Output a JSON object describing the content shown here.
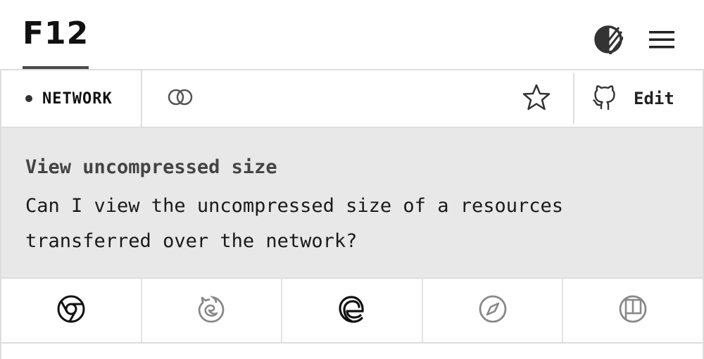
{
  "header": {
    "logo_text": "F12",
    "theme_icon": "contrast-icon",
    "menu_icon": "hamburger-menu-icon"
  },
  "toolbar": {
    "category_label": "NETWORK",
    "link_icon": "link-icon",
    "star_icon": "star-icon",
    "edit_icon": "github-icon",
    "edit_label": "Edit"
  },
  "question": {
    "title": "View uncompressed size",
    "text": "Can I view the uncompressed size of a resources transferred over the network?"
  },
  "browsers": [
    {
      "name": "chrome",
      "icon": "chrome-icon",
      "color": "#111111"
    },
    {
      "name": "firefox",
      "icon": "firefox-icon",
      "color": "#888888"
    },
    {
      "name": "edge",
      "icon": "edge-icon",
      "color": "#111111"
    },
    {
      "name": "safari",
      "icon": "safari-icon",
      "color": "#888888"
    },
    {
      "name": "polypane",
      "icon": "polypane-icon",
      "color": "#888888"
    }
  ],
  "colors": {
    "panel_bg": "#e8e8e8",
    "border": "#dddddd",
    "text": "#1a1a1a",
    "muted": "#888888"
  }
}
